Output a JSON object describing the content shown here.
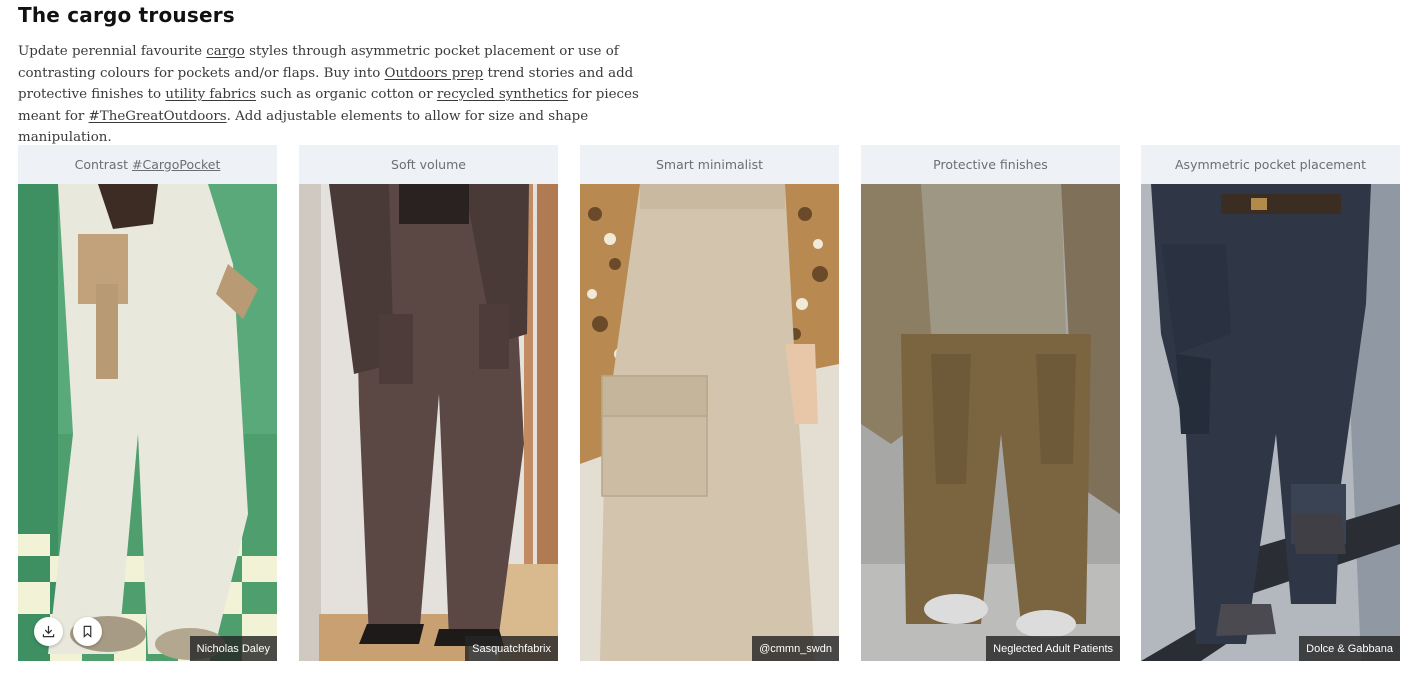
{
  "section": {
    "title": "The cargo trousers",
    "intro": [
      {
        "t": "Update perennial favourite ",
        "link": false
      },
      {
        "t": "cargo",
        "link": true
      },
      {
        "t": " styles through asymmetric pocket placement or use of contrasting colours for pockets and/or flaps. Buy into ",
        "link": false
      },
      {
        "t": "Outdoors prep",
        "link": true
      },
      {
        "t": " trend stories and add protective finishes to ",
        "link": false
      },
      {
        "t": "utility fabrics",
        "link": true
      },
      {
        "t": " such as organic cotton or ",
        "link": false
      },
      {
        "t": "recycled synthetics",
        "link": true
      },
      {
        "t": " for pieces meant for ",
        "link": false
      },
      {
        "t": "#TheGreatOutdoors",
        "link": true
      },
      {
        "t": ". Add adjustable elements to allow for size and shape manipulation.",
        "link": false
      }
    ]
  },
  "cards": [
    {
      "header": "Contrast",
      "header_link": "#CargoPocket",
      "credit": "Nicholas Daley",
      "has_actions": true
    },
    {
      "header": "Soft volume",
      "credit": "Sasquatchfabrix",
      "has_actions": false
    },
    {
      "header": "Smart minimalist",
      "credit": "@cmmn_swdn",
      "has_actions": false
    },
    {
      "header": "Protective finishes",
      "credit": "Neglected Adult Patients",
      "has_actions": false
    },
    {
      "header": "Asymmetric pocket placement",
      "credit": "Dolce & Gabbana",
      "has_actions": false
    }
  ],
  "actions": {
    "download_icon": "download-icon",
    "bookmark_icon": "bookmark-icon"
  }
}
